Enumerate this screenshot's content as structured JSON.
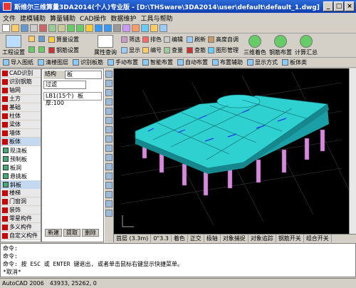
{
  "window": {
    "title": "斯维尔三维算量3DA2014(个人)专业版 - [D:\\THSware\\3DA2014\\user\\default\\default_1.dwg]"
  },
  "menu": [
    "文件",
    "建模辅助",
    "算量辅助",
    "CAD操作",
    "数据维护",
    "工具与帮助"
  ],
  "toolbar_big": {
    "project_settings": "工程设置",
    "calc_settings": "算量设置",
    "rebar_settings": "钢筋设置",
    "attr_query": "属性查询",
    "three_color": "三维着色",
    "rebar_layout": "钢筋布置",
    "calc_report": "计算汇总"
  },
  "toolbar_small": [
    "筛选",
    "排色",
    "编辑",
    "刷新",
    "高度自调",
    "显示",
    "编号",
    "查量",
    "查筋",
    "图形管理"
  ],
  "toolbar3": [
    "导入图纸",
    "清楼图层",
    "识别板筋",
    "手动布置",
    "智能布置",
    "自动布置",
    "布置辅助",
    "显示方式",
    "板体类"
  ],
  "left_panel": {
    "top_items": [
      "CAD识别",
      "识别钢筋",
      "轴网",
      "土方",
      "基础",
      "柱体",
      "梁体",
      "墙体",
      "板体"
    ],
    "sub_items": [
      "现浇板",
      "预制板",
      "板洞",
      "悬挑板",
      "斜板"
    ],
    "bottom_items": [
      "楼梯",
      "门窗洞",
      "装饰",
      "零星构件",
      "多义构件",
      "自定义构件"
    ]
  },
  "mid_panel": {
    "combo1_label": "结构",
    "combo1_value": "板",
    "combo2_value": "过滤",
    "selected": "LB1(15个)",
    "col_label": "板厚:100",
    "buttons": [
      "新建",
      "提取",
      "删除"
    ]
  },
  "bottom_bar": [
    "首层 (3.3m)",
    "0\"3.3",
    "着色",
    "正交",
    "极轴",
    "对象捕捉",
    "对象追踪",
    "钢筋开关",
    "组合开关"
  ],
  "command": [
    "命令:",
    "命令:",
    "命令:  按 ESC 或 ENTER 键退出, 或者单击鼠标右键显示快捷菜单。",
    "*取消*",
    "命令:"
  ],
  "status": {
    "app": "AutoCAD 2006",
    "coords": "43933, 25262, 0"
  },
  "colors": {
    "slab": "#29d6d6",
    "column": "#d28cd8",
    "canvas": "#000000",
    "title": "#1a4fc4"
  }
}
